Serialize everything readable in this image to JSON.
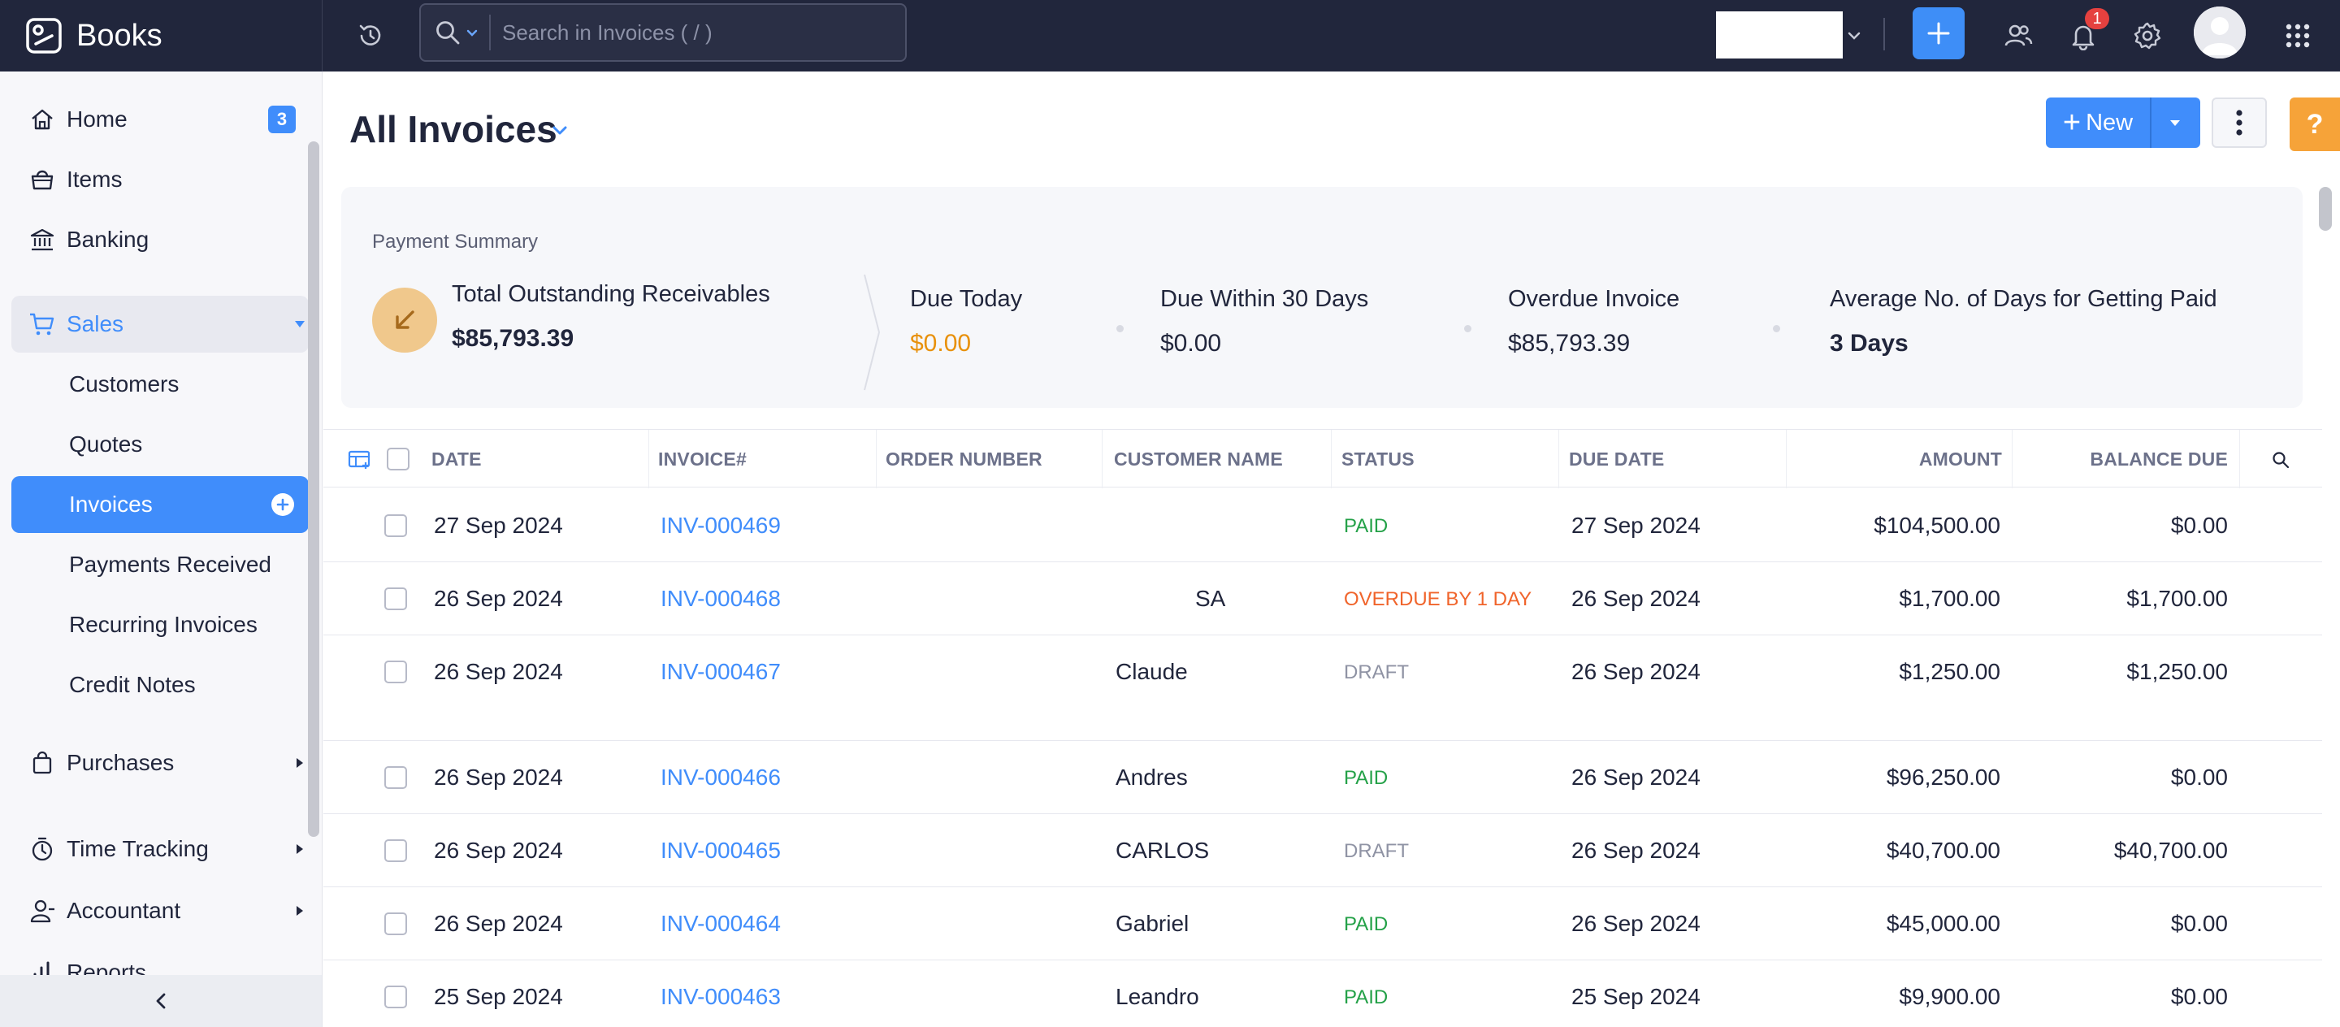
{
  "app": {
    "name": "Books"
  },
  "topbar": {
    "search_placeholder": "Search in Invoices ( / )",
    "notifications_count": "1"
  },
  "sidebar": {
    "home": {
      "label": "Home",
      "badge": "3"
    },
    "items": {
      "label": "Items"
    },
    "banking": {
      "label": "Banking"
    },
    "sales": {
      "label": "Sales",
      "children": [
        "Customers",
        "Quotes",
        "Invoices",
        "Payments Received",
        "Recurring Invoices",
        "Credit Notes"
      ]
    },
    "purchases": {
      "label": "Purchases"
    },
    "time_tracking": {
      "label": "Time Tracking"
    },
    "accountant": {
      "label": "Accountant"
    },
    "reports": {
      "label": "Reports"
    }
  },
  "page": {
    "title": "All Invoices",
    "new_button": "New"
  },
  "summary": {
    "title": "Payment Summary",
    "total_label": "Total Outstanding Receivables",
    "total_value": "$85,793.39",
    "due_today_label": "Due Today",
    "due_today_value": "$0.00",
    "due_30_label": "Due Within 30 Days",
    "due_30_value": "$0.00",
    "overdue_label": "Overdue Invoice",
    "overdue_value": "$85,793.39",
    "avg_days_label": "Average No. of Days for Getting Paid",
    "avg_days_value": "3 Days"
  },
  "table": {
    "columns": [
      "DATE",
      "INVOICE#",
      "ORDER NUMBER",
      "CUSTOMER NAME",
      "STATUS",
      "DUE DATE",
      "AMOUNT",
      "BALANCE DUE"
    ],
    "rows": [
      {
        "date": "27 Sep 2024",
        "invoice": "INV-000469",
        "order": "",
        "customer": "",
        "status": "PAID",
        "due": "27 Sep 2024",
        "amount": "$104,500.00",
        "balance": "$0.00"
      },
      {
        "date": "26 Sep 2024",
        "invoice": "INV-000468",
        "order": "",
        "customer": "SA",
        "status": "OVERDUE BY 1 DAY",
        "due": "26 Sep 2024",
        "amount": "$1,700.00",
        "balance": "$1,700.00"
      },
      {
        "date": "26 Sep 2024",
        "invoice": "INV-000467",
        "order": "",
        "customer": "Claude",
        "status": "DRAFT",
        "due": "26 Sep 2024",
        "amount": "$1,250.00",
        "balance": "$1,250.00"
      },
      {
        "date": "26 Sep 2024",
        "invoice": "INV-000466",
        "order": "",
        "customer": "Andres",
        "status": "PAID",
        "due": "26 Sep 2024",
        "amount": "$96,250.00",
        "balance": "$0.00"
      },
      {
        "date": "26 Sep 2024",
        "invoice": "INV-000465",
        "order": "",
        "customer": "CARLOS",
        "status": "DRAFT",
        "due": "26 Sep 2024",
        "amount": "$40,700.00",
        "balance": "$40,700.00"
      },
      {
        "date": "26 Sep 2024",
        "invoice": "INV-000464",
        "order": "",
        "customer": "Gabriel",
        "status": "PAID",
        "due": "26 Sep 2024",
        "amount": "$45,000.00",
        "balance": "$0.00"
      },
      {
        "date": "25 Sep 2024",
        "invoice": "INV-000463",
        "order": "",
        "customer": "Leandro",
        "status": "PAID",
        "due": "25 Sep 2024",
        "amount": "$9,900.00",
        "balance": "$0.00"
      }
    ]
  },
  "colors": {
    "topbar": "#21263c",
    "accent": "#408dfb",
    "paid": "#24a148",
    "overdue": "#f0642b",
    "draft": "#8f93a4",
    "due_today": "#e8910c"
  }
}
